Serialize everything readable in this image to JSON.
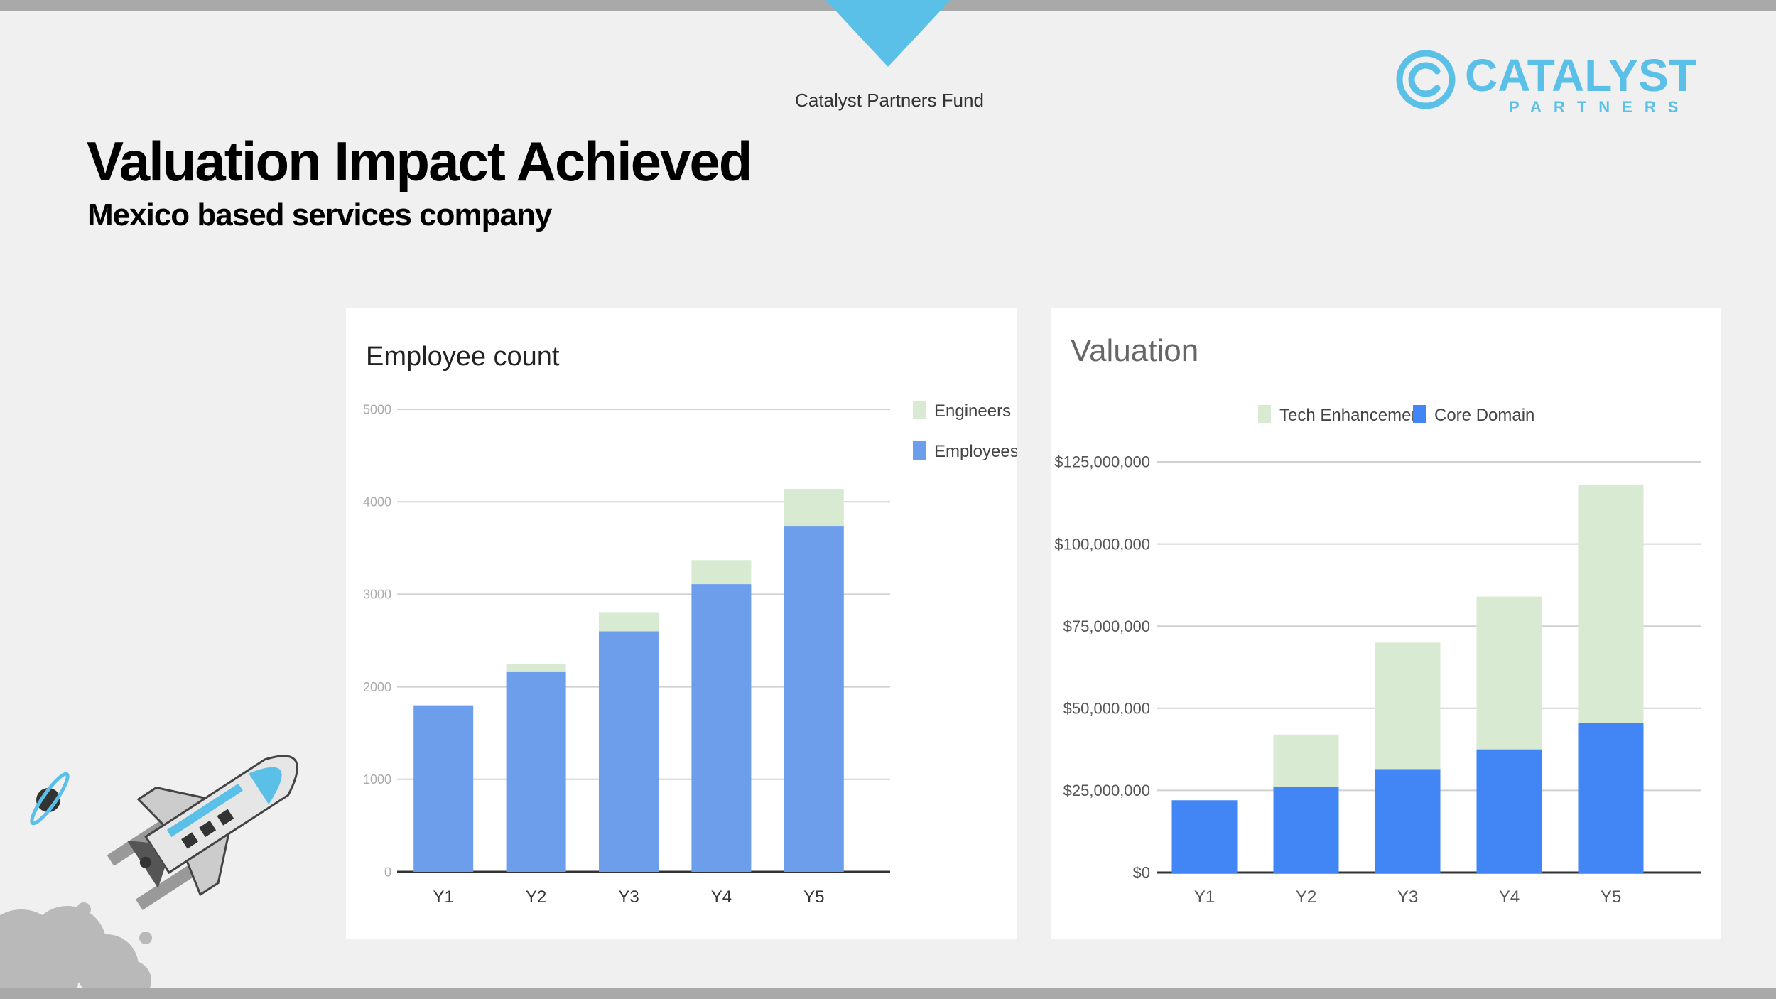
{
  "header": {
    "fund_label": "Catalyst Partners Fund",
    "logo_word": "CATALYST",
    "logo_sub": "PARTNERS"
  },
  "slide": {
    "title": "Valuation Impact Achieved",
    "subtitle": "Mexico based services company"
  },
  "colors": {
    "accent": "#5bc0e8",
    "bar_gray": "#a9a9a9",
    "employees": "#6d9eeb",
    "engineers": "#d9ead3",
    "core_domain": "#4285f4",
    "tech_enhancement": "#d9ead3"
  },
  "chart_data": [
    {
      "type": "bar",
      "stacked": true,
      "title": "Employee count",
      "categories": [
        "Y1",
        "Y2",
        "Y3",
        "Y4",
        "Y5"
      ],
      "series": [
        {
          "name": "Employees",
          "values": [
            1800,
            2160,
            2600,
            3110,
            3740
          ]
        },
        {
          "name": "Engineers",
          "values": [
            0,
            90,
            200,
            260,
            400
          ]
        }
      ],
      "ylim": [
        0,
        5000
      ],
      "yticks": [
        "0",
        "1000",
        "2000",
        "3000",
        "4000",
        "5000"
      ],
      "legend": "right",
      "grid": true
    },
    {
      "type": "bar",
      "stacked": true,
      "title": "Valuation",
      "categories": [
        "Y1",
        "Y2",
        "Y3",
        "Y4",
        "Y5"
      ],
      "series": [
        {
          "name": "Core Domain",
          "values": [
            22000000,
            26000000,
            31500000,
            37500000,
            45500000
          ]
        },
        {
          "name": "Tech Enhancement",
          "values": [
            0,
            16000000,
            38500000,
            46500000,
            72500000
          ]
        }
      ],
      "ylim": [
        0,
        125000000
      ],
      "yticks": [
        "$0",
        "$25,000,000",
        "$50,000,000",
        "$75,000,000",
        "$100,000,000",
        "$125,000,000"
      ],
      "legend": "top",
      "grid": true
    }
  ]
}
